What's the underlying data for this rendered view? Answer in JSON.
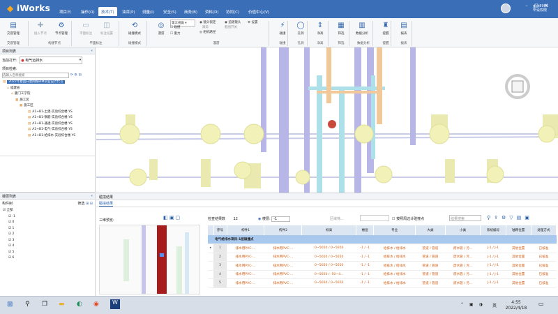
{
  "app": {
    "logo": "iWorks",
    "menus": [
      "项目日",
      "操作(O)",
      "技术(T)",
      "油漆(P)",
      "测量(I)",
      "安全(S)",
      "商务(B)",
      "资料(D)",
      "协同(C)",
      "价值中心(V)"
    ],
    "active_menu": 2,
    "user_name": "gkh8986",
    "user_role": "毕设权限"
  },
  "ribbon": {
    "buttons": [
      {
        "label": "交底管理",
        "icon": "▤"
      },
      {
        "label": "插入节点",
        "icon": "✚"
      },
      {
        "label": "节点管理",
        "icon": "⚙"
      },
      {
        "label": "平面标注",
        "icon": "▭"
      },
      {
        "label": "标注设置",
        "icon": "◫"
      },
      {
        "label": "碰撞模式",
        "icon": "⟲"
      },
      {
        "label": "漫游",
        "icon": "◎"
      },
      {
        "label": "碰撞",
        "icon": "⚡"
      },
      {
        "label": "孔洞",
        "icon": "◯"
      },
      {
        "label": "净高",
        "icon": "⇕"
      },
      {
        "label": "筛选",
        "icon": "▦"
      },
      {
        "label": "数据分析",
        "icon": "▥"
      },
      {
        "label": "提醒",
        "icon": "♜"
      },
      {
        "label": "报表",
        "icon": "▤"
      }
    ],
    "groups": [
      "交底管理",
      "构建节点",
      "平面标注",
      "碰撞模式",
      "漫游",
      "碰撞",
      "孔洞",
      "净高",
      "筛选",
      "数据分析",
      "提醒",
      "报表"
    ],
    "roam_select": "第三视角",
    "roam_opts": [
      "碰撞",
      "重力"
    ],
    "roam_extra": [
      "镜头锁定",
      "跟踪",
      "相机路径",
      "追随镜头",
      "截图开关",
      "设置"
    ]
  },
  "left": {
    "project_header": "项目列表",
    "current_open_label": "当前打开:",
    "current_open": "电气运排水",
    "project_search_label": "项目检索:",
    "project_search_placeholder": "选输入名称搜索",
    "tree": [
      "2022年春回开会网络BIM毕业设计代写",
      "福建省",
      "厦门工学院",
      "施工区",
      "施工区",
      "A1+B1-土建-实验综合楼.YS",
      "A1+B1-钢筋-实验综合楼.YS",
      "A1+B1-通透-实验综合楼.YS",
      "A1+B1-电气-实验综合楼.YS",
      "A1+B1-给排水-实验综合楼.YS"
    ],
    "floor_header": "楼层列表",
    "floor_tab": "构件树",
    "floor_filter": "筛选",
    "floors": [
      "全部",
      "-1",
      "0",
      "1",
      "2",
      "3",
      "4",
      "5",
      "6"
    ]
  },
  "bottom": {
    "panel_title": "碰撞结果",
    "tab": "碰撞结果",
    "preview_label": "三维预览:",
    "count_label": "检查结果数",
    "count": "12",
    "floor_label": "楼层:",
    "floor_value": "-1",
    "region_label": "区域筛...",
    "check_label": "按照周边计碰撞点",
    "search_placeholder": "结果搜索",
    "group_row": "电气给排水项目-1层碰撞点",
    "columns": [
      "序号",
      "构件1",
      "构件2",
      "标高",
      "楼层",
      "专业",
      "大类",
      "小类",
      "系统编号",
      "轴网位置",
      "处理方式"
    ],
    "rows": [
      [
        "1",
        "排水用PVC-...",
        "排水用PVC-...",
        "0~5650 / 0~5650",
        "-1 / -1",
        "给排水 / 给排水",
        "管道 / 管道",
        "废水管 / 污...",
        "J-1 / J-1",
        "其他位置",
        "已核准"
      ],
      [
        "2",
        "排水用PVC-...",
        "排水用PVC-...",
        "0~5650 / 0~5650",
        "-1 / -1",
        "给排水 / 给排水",
        "管道 / 管道",
        "废水管 / 污...",
        "J-1 / J-1",
        "其他位置",
        "已核准"
      ],
      [
        "3",
        "排水用PVC-...",
        "排水用PVC-...",
        "0~5650 / 0~5650",
        "-1 / -1",
        "给排水 / 给排水",
        "管道 / 管道",
        "废水管 / 污...",
        "J-1 / J-1",
        "其他位置",
        "已核准"
      ],
      [
        "4",
        "排水用PVC-...",
        "排水用PVC-...",
        "0~5650 / -50~4...",
        "-1 / -1",
        "给排水 / 给排水",
        "管道 / 管道",
        "废水管 / 污...",
        "J-1 / J-1",
        "其他位置",
        "已核准"
      ],
      [
        "5",
        "排水用PVC-...",
        "排水用PVC-...",
        "0~5650 / 0~5650",
        "-1 / -1",
        "给排水 / 给排水",
        "管道 / 管道",
        "废水管 / 污...",
        "J-1 / J-1",
        "其他位置",
        "已核准"
      ]
    ]
  },
  "taskbar": {
    "time": "4:55",
    "date": "2022/4/18",
    "ime": "英"
  }
}
